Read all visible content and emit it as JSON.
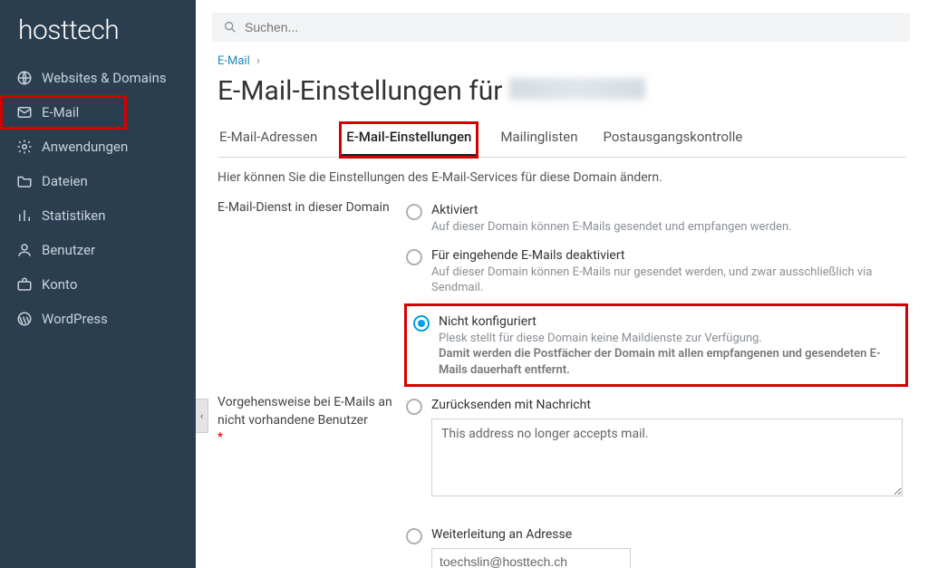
{
  "brand": "hosttech",
  "search": {
    "placeholder": "Suchen..."
  },
  "sidebar": {
    "items": [
      {
        "label": "Websites & Domains",
        "icon": "globe"
      },
      {
        "label": "E-Mail",
        "icon": "mail",
        "highlight": true
      },
      {
        "label": "Anwendungen",
        "icon": "gear"
      },
      {
        "label": "Dateien",
        "icon": "folder"
      },
      {
        "label": "Statistiken",
        "icon": "stats"
      },
      {
        "label": "Benutzer",
        "icon": "user"
      },
      {
        "label": "Konto",
        "icon": "account"
      },
      {
        "label": "WordPress",
        "icon": "wordpress"
      }
    ]
  },
  "breadcrumb": {
    "root": "E-Mail"
  },
  "page": {
    "title_prefix": "E-Mail-Einstellungen für"
  },
  "tabs": {
    "addresses": "E-Mail-Adressen",
    "settings": "E-Mail-Einstellungen",
    "mailinglists": "Mailinglisten",
    "outgoing": "Postausgangskontrolle"
  },
  "intro": "Hier können Sie die Einstellungen des E-Mail-Services für diese Domain ändern.",
  "section1": {
    "label": "E-Mail-Dienst in dieser Domain",
    "opt_active": {
      "title": "Aktiviert",
      "sub": "Auf dieser Domain können E-Mails gesendet und empfangen werden."
    },
    "opt_incoming_off": {
      "title": "Für eingehende E-Mails deaktiviert",
      "sub": "Auf dieser Domain können E-Mails nur gesendet werden, und zwar ausschließlich via Sendmail."
    },
    "opt_unconfigured": {
      "title": "Nicht konfiguriert",
      "sub1": "Plesk stellt für diese Domain keine Maildienste zur Verfügung.",
      "sub2": "Damit werden die Postfächer der Domain mit allen empfangenen und gesendeten E-Mails dauerhaft entfernt."
    }
  },
  "section2": {
    "label": "Vorgehensweise bei E-Mails an nicht vorhandene Benutzer",
    "required_mark": "*",
    "opt_bounce": {
      "title": "Zurücksenden mit Nachricht",
      "value": "This address no longer accepts mail."
    },
    "opt_forward": {
      "title": "Weiterleitung an Adresse",
      "value": "toechslin@hosttech.ch"
    }
  }
}
